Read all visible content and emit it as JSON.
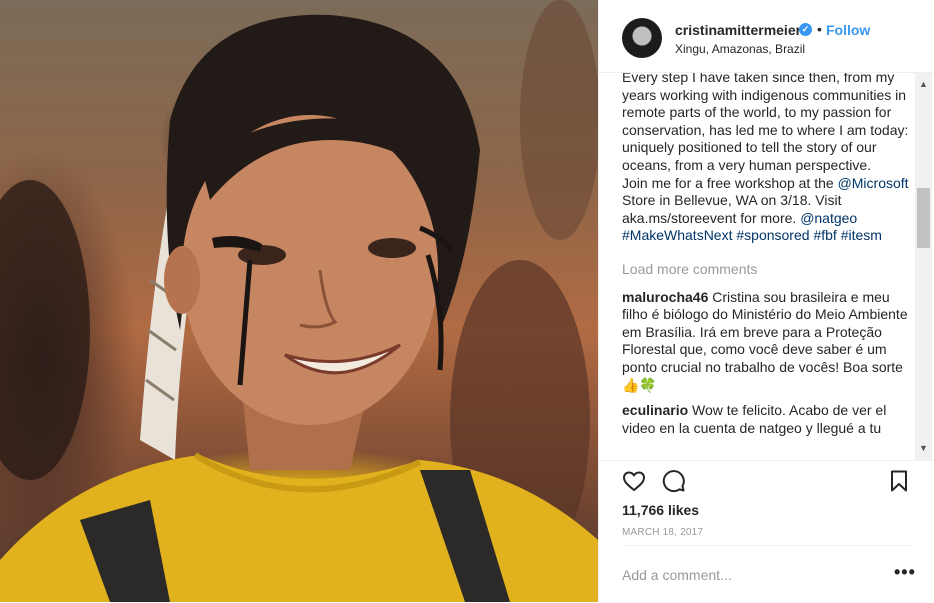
{
  "post": {
    "username": "cristinamittermeier",
    "verified_icon": "verified-check-icon",
    "follow_label": "Follow",
    "separator": "•",
    "location": "Xingu, Amazonas, Brazil"
  },
  "caption": {
    "lines_before_link": "Every step I have taken since then, from my years working with indigenous communities in remote parts of the world, to my passion for conservation, has led me to where I am today: uniquely positioned to tell the story of our oceans, from a very human perspective.\nJoin me for a free workshop at the ",
    "mention_microsoft": "@Microsoft",
    "text_after_microsoft": " Store in Bellevue, WA on 3/18. Visit aka.ms/storeevent for more. ",
    "mention_natgeo": "@natgeo",
    "hashtag_makewhatsnext": "#MakeWhatsNext",
    "hashtag_sponsored": "#sponsored",
    "hashtag_fbf": "#fbf",
    "hashtag_itesm": "#itesm"
  },
  "load_more_label": "Load more comments",
  "comments": [
    {
      "user": "malurocha46",
      "text": "Cristina sou brasileira e meu filho é biólogo do Ministério do Meio Ambiente em Brasília. Irá em breve para a Proteção Florestal que, como você deve saber é um ponto crucial no trabalho de vocês! Boa sorte 👍🍀"
    },
    {
      "user": "eculinario",
      "text": "Wow te felicito. Acabo de ver el video en la cuenta de natgeo y llegué a tu"
    }
  ],
  "actions": {
    "like_icon": "heart-outline-icon",
    "comment_icon": "comment-bubble-icon",
    "save_icon": "bookmark-icon"
  },
  "likes": "11,766 likes",
  "date": "MARCH 18, 2017",
  "add_comment": {
    "placeholder": "Add a comment...",
    "more_label": "•••"
  },
  "scrollbar": {
    "up_glyph": "▲",
    "down_glyph": "▼"
  }
}
